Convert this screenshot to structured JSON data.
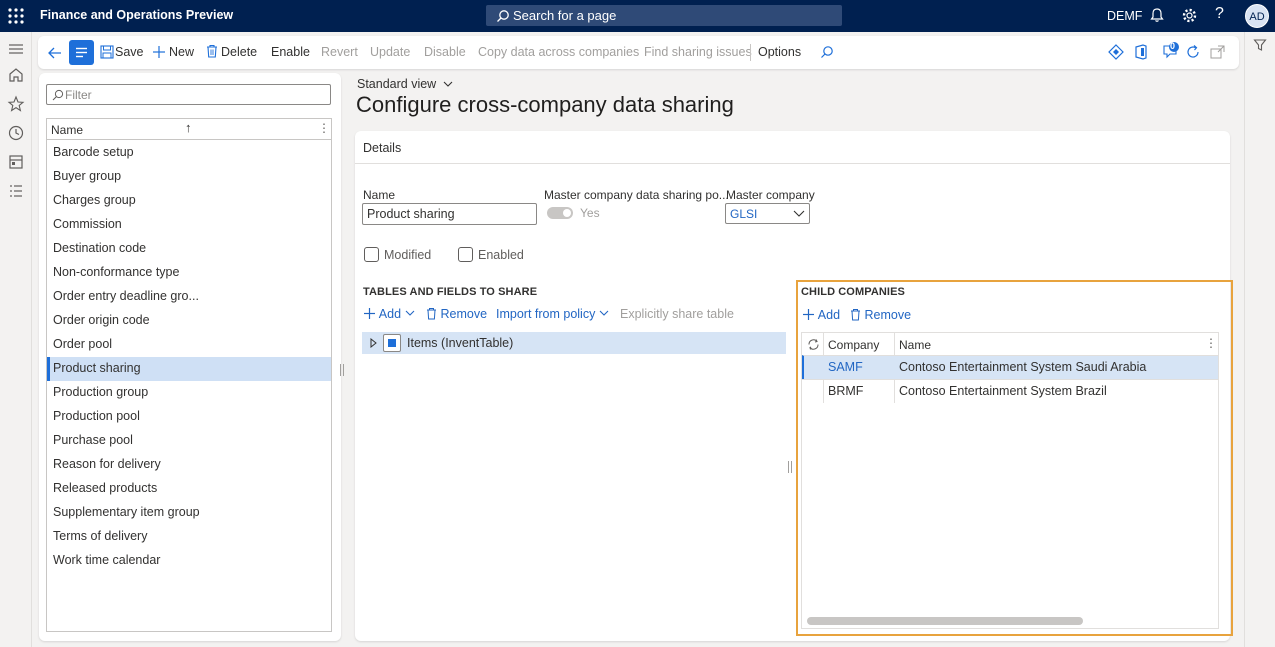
{
  "header": {
    "app_title": "Finance and Operations Preview",
    "search_label": "Search for a page",
    "company": "DEMF",
    "help_glyph": "?",
    "avatar_initials": "AD"
  },
  "actions": {
    "save": "Save",
    "new": "New",
    "delete": "Delete",
    "enable": "Enable",
    "revert": "Revert",
    "update": "Update",
    "disable": "Disable",
    "copy": "Copy data across companies",
    "find": "Find sharing issues",
    "options": "Options",
    "badge_count": "0"
  },
  "list": {
    "filter_placeholder": "Filter",
    "column": "Name",
    "sort_glyph": "↑",
    "more_glyph": "⋮",
    "items": [
      "Barcode setup",
      "Buyer group",
      "Charges group",
      "Commission",
      "Destination code",
      "Non-conformance type",
      "Order entry deadline gro...",
      "Order origin code",
      "Order pool",
      "Product sharing",
      "Production group",
      "Production pool",
      "Purchase pool",
      "Reason for delivery",
      "Released products",
      "Supplementary item group",
      "Terms of delivery",
      "Work time calendar"
    ],
    "selected_index": 9
  },
  "main": {
    "view": "Standard view",
    "title": "Configure cross-company data sharing",
    "details_header": "Details",
    "name_label": "Name",
    "name_value": "Product sharing",
    "policy_label": "Master company data sharing po...",
    "policy_value": "Yes",
    "master_label": "Master company",
    "master_value": "GLSI",
    "modified_label": "Modified",
    "enabled_label": "Enabled"
  },
  "tables": {
    "header": "TABLES AND FIELDS TO SHARE",
    "add": "Add",
    "remove": "Remove",
    "import": "Import from policy",
    "explicit": "Explicitly share table",
    "row": "Items (InventTable)"
  },
  "child": {
    "header": "CHILD COMPANIES",
    "add": "Add",
    "remove": "Remove",
    "col_company": "Company",
    "col_name": "Name",
    "more_glyph": "⋮",
    "rows": [
      {
        "company": "SAMF",
        "name": "Contoso Entertainment System Saudi Arabia"
      },
      {
        "company": "BRMF",
        "name": "Contoso Entertainment System Brazil"
      }
    ]
  },
  "colors": {
    "topbar": "#002050",
    "accent": "#1e6fd9",
    "link": "#2266c3",
    "highlight_border": "#e8a33d",
    "selected_row": "#cfe0f5"
  }
}
